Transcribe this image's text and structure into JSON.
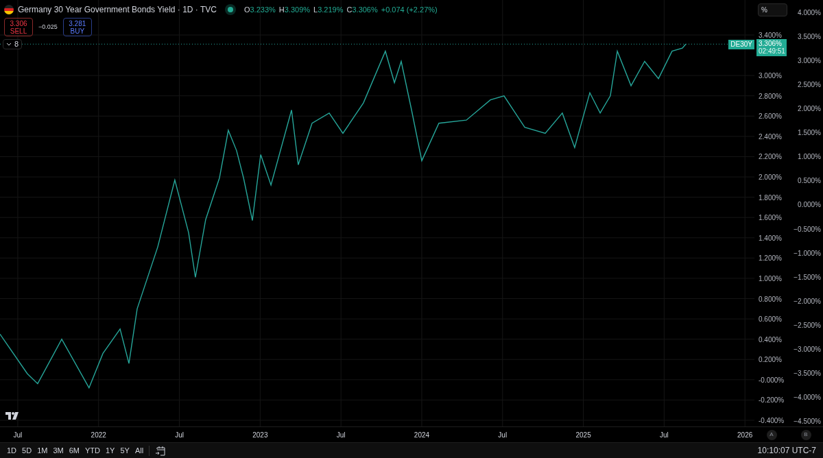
{
  "legend": {
    "title": "Germany 30 Year Government Bonds Yield · 1D · TVC",
    "ohlc": [
      {
        "label": "O",
        "value": "3.233%"
      },
      {
        "label": "H",
        "value": "3.309%"
      },
      {
        "label": "L",
        "value": "3.219%"
      },
      {
        "label": "C",
        "value": "3.306%"
      }
    ],
    "change": "+0.074 (+2.27%)"
  },
  "trade": {
    "sell": {
      "price": "3.306",
      "label": "SELL"
    },
    "spread": "−0.025",
    "buy": {
      "price": "3.281",
      "label": "BUY"
    }
  },
  "indicators_toggle": {
    "count": "8"
  },
  "scale_mode": "%",
  "price_line": {
    "price": "3.306%",
    "countdown": "02:49:51"
  },
  "chart_data": {
    "type": "line",
    "x": [
      2021.39,
      2021.559,
      2021.623,
      2021.772,
      2021.941,
      2022.027,
      2022.133,
      2022.188,
      2022.239,
      2022.366,
      2022.472,
      2022.557,
      2022.599,
      2022.663,
      2022.748,
      2022.803,
      2022.854,
      2022.897,
      2022.952,
      2023.003,
      2023.067,
      2023.194,
      2023.236,
      2023.321,
      2023.427,
      2023.512,
      2023.639,
      2023.775,
      2023.831,
      2023.873,
      2023.937,
      2024.0,
      2024.106,
      2024.276,
      2024.425,
      2024.509,
      2024.637,
      2024.764,
      2024.87,
      2024.946,
      2025.04,
      2025.104,
      2025.167,
      2025.21,
      2025.295,
      2025.379,
      2025.465,
      2025.549,
      2025.613,
      2025.634
    ],
    "series": [
      {
        "name": "DE30Y",
        "color": "#26a69a",
        "values": [
          0.45,
          0.06,
          -0.04,
          0.4,
          -0.08,
          0.26,
          0.5,
          0.16,
          0.7,
          1.31,
          1.97,
          1.45,
          1.01,
          1.58,
          1.99,
          2.46,
          2.26,
          1.99,
          1.57,
          2.22,
          1.92,
          2.66,
          2.12,
          2.53,
          2.63,
          2.43,
          2.73,
          3.24,
          2.93,
          3.14,
          2.66,
          2.16,
          2.53,
          2.56,
          2.76,
          2.8,
          2.49,
          2.43,
          2.63,
          2.29,
          2.83,
          2.63,
          2.8,
          3.24,
          2.9,
          3.14,
          2.97,
          3.24,
          3.27,
          3.31
        ]
      }
    ],
    "grid": true,
    "xlim": [
      2021.39,
      2026.483
    ],
    "ylim": [
      -0.461,
      3.745
    ],
    "xticks": [
      {
        "value": 2021.5,
        "label": "Jul"
      },
      {
        "value": 2022,
        "label": "2022"
      },
      {
        "value": 2022.5,
        "label": "Jul"
      },
      {
        "value": 2023,
        "label": "2023"
      },
      {
        "value": 2023.5,
        "label": "Jul"
      },
      {
        "value": 2024,
        "label": "2024"
      },
      {
        "value": 2024.5,
        "label": "Jul"
      },
      {
        "value": 2025,
        "label": "2025"
      },
      {
        "value": 2025.5,
        "label": "Jul"
      },
      {
        "value": 2026,
        "label": "2026"
      }
    ],
    "yticks": [
      {
        "value": 3.4,
        "label": "3.400%"
      },
      {
        "value": 3.0,
        "label": "3.000%"
      },
      {
        "value": 2.8,
        "label": "2.800%"
      },
      {
        "value": 2.6,
        "label": "2.600%"
      },
      {
        "value": 2.4,
        "label": "2.400%"
      },
      {
        "value": 2.2,
        "label": "2.200%"
      },
      {
        "value": 2.0,
        "label": "2.000%"
      },
      {
        "value": 1.8,
        "label": "1.800%"
      },
      {
        "value": 1.6,
        "label": "1.600%"
      },
      {
        "value": 1.4,
        "label": "1.400%"
      },
      {
        "value": 1.2,
        "label": "1.200%"
      },
      {
        "value": 1.0,
        "label": "1.000%"
      },
      {
        "value": 0.8,
        "label": "0.800%"
      },
      {
        "value": 0.6,
        "label": "0.600%"
      },
      {
        "value": 0.4,
        "label": "0.400%"
      },
      {
        "value": 0.2,
        "label": "0.200%"
      },
      {
        "value": 0,
        "label": "-0.000%"
      },
      {
        "value": -0.2,
        "label": "-0.200%"
      },
      {
        "value": -0.4,
        "label": "-0.400%"
      }
    ]
  },
  "percent_axis": [
    "4.000%",
    "3.500%",
    "3.000%",
    "2.500%",
    "2.000%",
    "1.500%",
    "1.000%",
    "0.500%",
    "0.000%",
    "−0.500%",
    "−1.000%",
    "−1.500%",
    "−2.000%",
    "−2.500%",
    "−3.000%",
    "−3.500%",
    "−4.000%",
    "−4.500%"
  ],
  "scale_buttons": [
    "A",
    "B"
  ],
  "ranges": [
    "1D",
    "5D",
    "1M",
    "3M",
    "6M",
    "YTD",
    "1Y",
    "5Y",
    "All"
  ],
  "clock": "10:10:07 UTC-7"
}
